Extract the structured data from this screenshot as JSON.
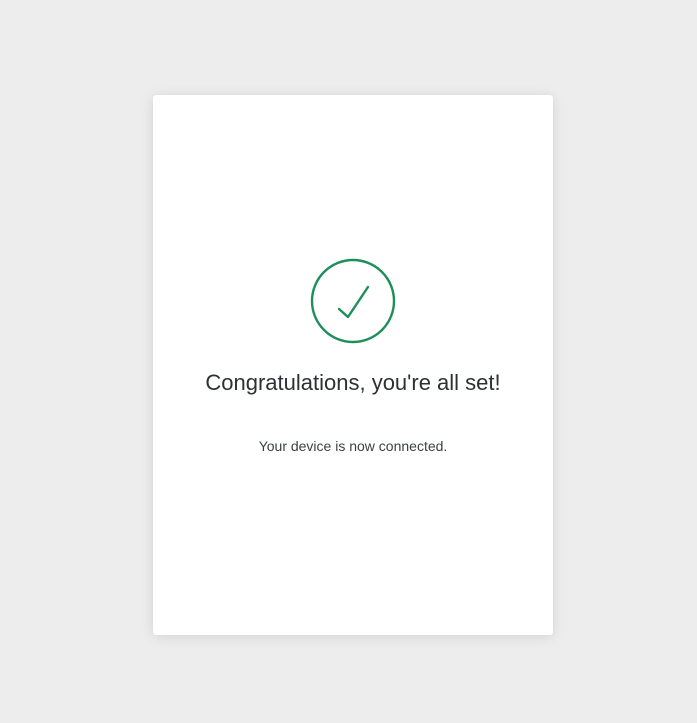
{
  "status": {
    "icon": "checkmark-circle-icon",
    "icon_color": "#1e8e5a",
    "title": "Congratulations, you're all set!",
    "message": "Your device is now connected."
  },
  "colors": {
    "page_background": "#ededed",
    "card_background": "#ffffff",
    "title_text": "#2d3035",
    "message_text": "#3c4043"
  }
}
